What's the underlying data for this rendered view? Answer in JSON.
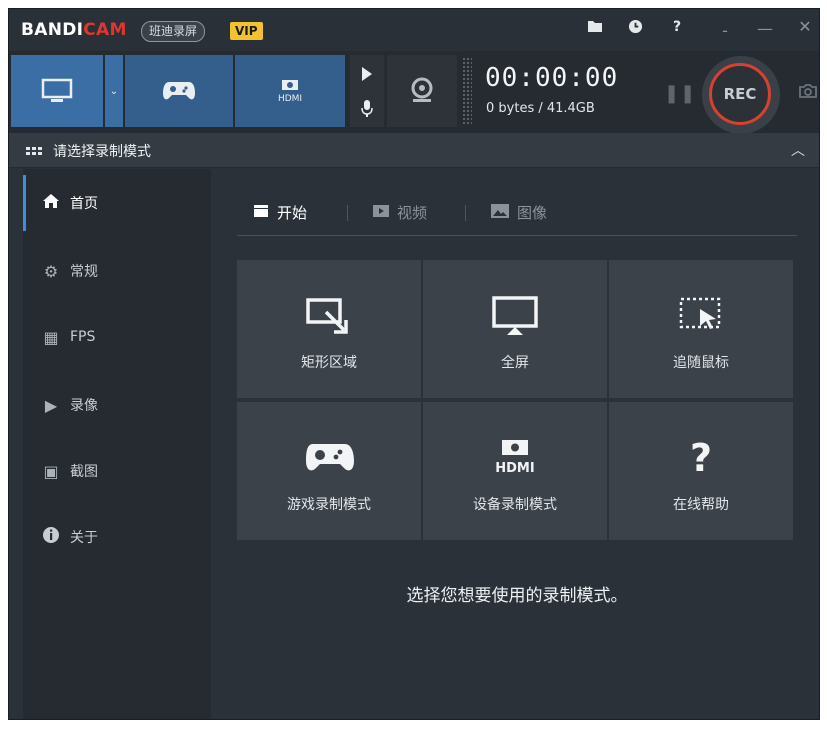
{
  "app": {
    "logo_part1": "BANDI",
    "logo_part2": "CAM",
    "cn_name": "班迪录屏",
    "vip": "VIP"
  },
  "titlebar_icons": [
    "folder-icon",
    "clock-icon",
    "help-icon"
  ],
  "window_controls": {
    "minimize": "-",
    "restore": "—",
    "close": "✕"
  },
  "toolbar": {
    "timer": "00:00:00",
    "size": "0 bytes / 41.4GB",
    "rec_label": "REC",
    "pause": "❚❚"
  },
  "section": {
    "title": "请选择录制模式"
  },
  "sidebar": {
    "items": [
      {
        "label": "首页",
        "icon": "home-icon",
        "glyph": "⌂"
      },
      {
        "label": "常规",
        "icon": "gear-icon",
        "glyph": "⚙"
      },
      {
        "label": "FPS",
        "icon": "fps-icon",
        "glyph": "▦"
      },
      {
        "label": "录像",
        "icon": "video-settings-icon",
        "glyph": "▶"
      },
      {
        "label": "截图",
        "icon": "image-settings-icon",
        "glyph": "▣"
      },
      {
        "label": "关于",
        "icon": "info-icon",
        "glyph": "ℹ"
      }
    ]
  },
  "tabs": [
    {
      "label": "开始",
      "icon": "clapper-icon"
    },
    {
      "label": "视频",
      "icon": "video-icon"
    },
    {
      "label": "图像",
      "icon": "image-icon"
    }
  ],
  "tiles": [
    {
      "label": "矩形区域",
      "icon": "rectangle-area-icon"
    },
    {
      "label": "全屏",
      "icon": "fullscreen-icon"
    },
    {
      "label": "追随鼠标",
      "icon": "follow-mouse-icon"
    },
    {
      "label": "游戏录制模式",
      "icon": "gamepad-icon"
    },
    {
      "label": "设备录制模式",
      "icon": "hdmi-device-icon"
    },
    {
      "label": "在线帮助",
      "icon": "help-icon"
    }
  ],
  "hint": "选择您想要使用的录制模式。",
  "colors": {
    "accent_blue": "#3a6ea5",
    "rec_red": "#d8402f",
    "vip_yellow": "#f2c230",
    "logo_red": "#e0362e"
  }
}
